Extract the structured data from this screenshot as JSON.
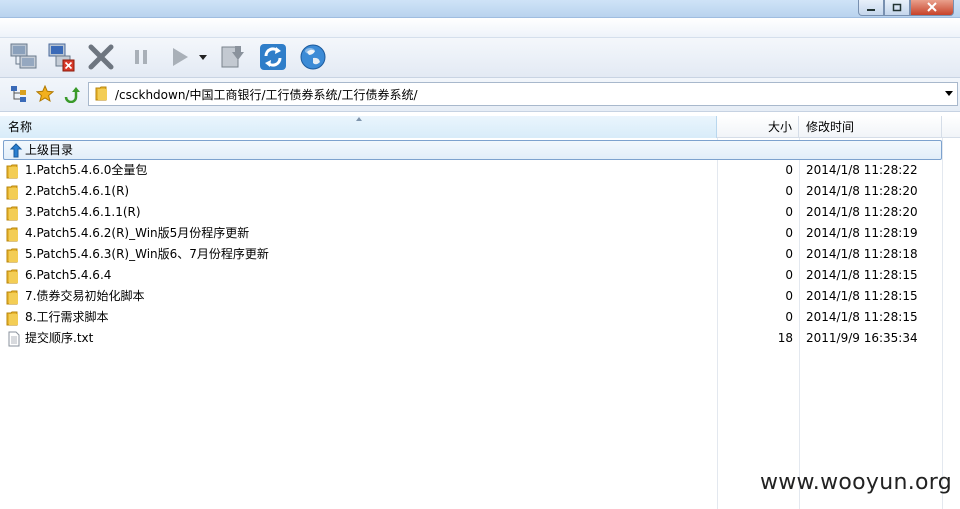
{
  "window": {
    "controls": [
      "minimize-icon",
      "maximize-icon",
      "close-icon"
    ]
  },
  "toolbar": {
    "buttons": [
      "connect-icon",
      "disconnect-icon",
      "abort-icon",
      "pause-icon",
      "play-icon",
      "play-dropdown-icon",
      "transfer-icon",
      "refresh-icon",
      "browser-icon"
    ]
  },
  "address_bar": {
    "icons": [
      "tree-view-icon",
      "favorites-star-icon",
      "go-up-icon"
    ],
    "path": "/csckhdown/中国工商银行/工行债券系统/工行债券系统/"
  },
  "columns": {
    "name": "名称",
    "size": "大小",
    "date": "修改时间"
  },
  "parent_dir": {
    "label": "上级目录"
  },
  "files": [
    {
      "name": "1.Patch5.4.6.0全量包",
      "size": "0",
      "date": "2014/1/8 11:28:22",
      "type": "folder"
    },
    {
      "name": "2.Patch5.4.6.1(R)",
      "size": "0",
      "date": "2014/1/8 11:28:20",
      "type": "folder"
    },
    {
      "name": "3.Patch5.4.6.1.1(R)",
      "size": "0",
      "date": "2014/1/8 11:28:20",
      "type": "folder"
    },
    {
      "name": "4.Patch5.4.6.2(R)_Win版5月份程序更新",
      "size": "0",
      "date": "2014/1/8 11:28:19",
      "type": "folder"
    },
    {
      "name": "5.Patch5.4.6.3(R)_Win版6、7月份程序更新",
      "size": "0",
      "date": "2014/1/8 11:28:18",
      "type": "folder"
    },
    {
      "name": "6.Patch5.4.6.4",
      "size": "0",
      "date": "2014/1/8 11:28:15",
      "type": "folder"
    },
    {
      "name": "7.债券交易初始化脚本",
      "size": "0",
      "date": "2014/1/8 11:28:15",
      "type": "folder"
    },
    {
      "name": "8.工行需求脚本",
      "size": "0",
      "date": "2014/1/8 11:28:15",
      "type": "folder"
    },
    {
      "name": "提交顺序.txt",
      "size": "18",
      "date": "2011/9/9 16:35:34",
      "type": "file"
    }
  ],
  "watermark": "www.wooyun.org",
  "colors": {
    "folder": "#e8b630",
    "selection_border": "#7da2ce",
    "titlebar": "#b9d3ee"
  }
}
